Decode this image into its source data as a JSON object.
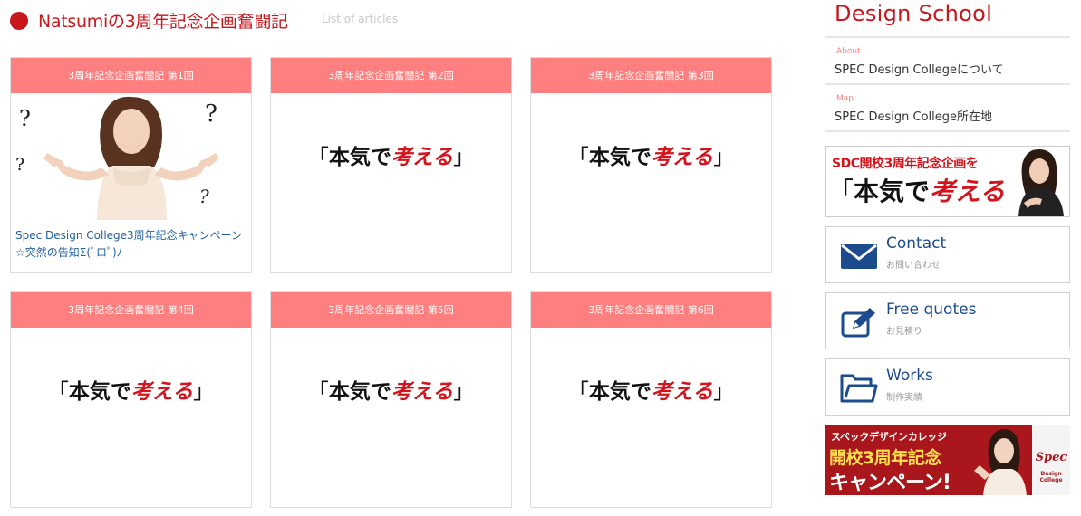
{
  "header": {
    "title": "Natsumiの3周年記念企画奮闘記",
    "subtitle": "List of articles"
  },
  "cards": [
    {
      "heading": "3周年記念企画奮闘記 第1回",
      "link": "Spec Design College3周年記念キャンペーン☆突然の告知Σ(ﾟロﾟ)ﾉ"
    },
    {
      "heading": "3周年記念企画奮闘記 第2回"
    },
    {
      "heading": "3周年記念企画奮闘記 第3回"
    },
    {
      "heading": "3周年記念企画奮闘記 第4回"
    },
    {
      "heading": "3周年記念企画奮闘記 第5回"
    },
    {
      "heading": "3周年記念企画奮闘記 第6回"
    }
  ],
  "logo_text": {
    "open": "「",
    "black": "本気で",
    "red": "考える",
    "close": "」"
  },
  "sidebar": {
    "brand": "Design School",
    "links": [
      {
        "eyebrow": "About",
        "title": "SPEC Design Collegeについて"
      },
      {
        "eyebrow": "Map",
        "title": "SPEC Design College所在地"
      }
    ],
    "banner1": {
      "top_text": "SDC開校3周年記念企画を"
    },
    "contact_boxes": [
      {
        "title": "Contact",
        "subtitle": "お問い合わせ",
        "icon": "envelope-icon"
      },
      {
        "title": "Free quotes",
        "subtitle": "お見積り",
        "icon": "edit-icon"
      },
      {
        "title": "Works",
        "subtitle": "制作実績",
        "icon": "folder-icon"
      }
    ],
    "banner2": {
      "kana": "スペックデザインカレッジ",
      "line1": "開校3周年記念",
      "line2": "キャンペーン!",
      "logo": "Spec",
      "logo_sub": "Design College"
    }
  },
  "colors": {
    "accent_red": "#c8161d",
    "card_header": "#fe7f7f",
    "link_blue": "#20609f",
    "contact_blue": "#1d4c8e"
  }
}
